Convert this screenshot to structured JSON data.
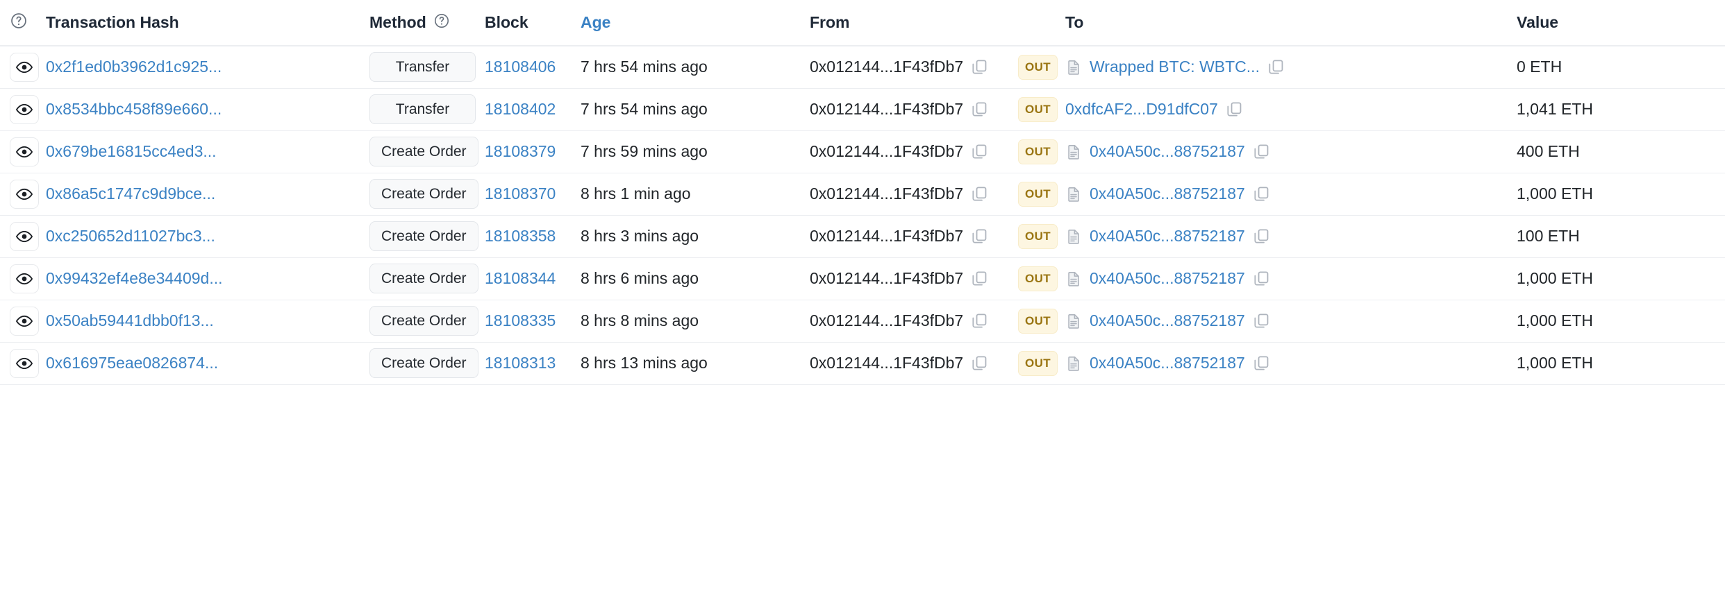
{
  "colors": {
    "link": "#3b82c4",
    "text": "#212529",
    "badge_bg": "#f8f9fa",
    "badge_border": "#e3e6ea",
    "out_bg": "#fdf6e1",
    "out_text": "#9a7512",
    "row_border": "#eceef1"
  },
  "table": {
    "headers": {
      "eye": "",
      "transaction_hash": "Transaction Hash",
      "method": "Method",
      "block": "Block",
      "age": "Age",
      "from": "From",
      "to": "To",
      "value": "Value"
    },
    "rows": [
      {
        "hash": "0x2f1ed0b3962d1c925...",
        "method": "Transfer",
        "block": "18108406",
        "age": "7 hrs 54 mins ago",
        "from": "0x012144...1F43fDb7",
        "direction": "OUT",
        "to": "Wrapped BTC: WBTC...",
        "to_is_contract": true,
        "value": "0 ETH"
      },
      {
        "hash": "0x8534bbc458f89e660...",
        "method": "Transfer",
        "block": "18108402",
        "age": "7 hrs 54 mins ago",
        "from": "0x012144...1F43fDb7",
        "direction": "OUT",
        "to": "0xdfcAF2...D91dfC07",
        "to_is_contract": false,
        "value": "1,041 ETH"
      },
      {
        "hash": "0x679be16815cc4ed3...",
        "method": "Create Order",
        "block": "18108379",
        "age": "7 hrs 59 mins ago",
        "from": "0x012144...1F43fDb7",
        "direction": "OUT",
        "to": "0x40A50c...88752187",
        "to_is_contract": true,
        "value": "400 ETH"
      },
      {
        "hash": "0x86a5c1747c9d9bce...",
        "method": "Create Order",
        "block": "18108370",
        "age": "8 hrs 1 min ago",
        "from": "0x012144...1F43fDb7",
        "direction": "OUT",
        "to": "0x40A50c...88752187",
        "to_is_contract": true,
        "value": "1,000 ETH"
      },
      {
        "hash": "0xc250652d11027bc3...",
        "method": "Create Order",
        "block": "18108358",
        "age": "8 hrs 3 mins ago",
        "from": "0x012144...1F43fDb7",
        "direction": "OUT",
        "to": "0x40A50c...88752187",
        "to_is_contract": true,
        "value": "100 ETH"
      },
      {
        "hash": "0x99432ef4e8e34409d...",
        "method": "Create Order",
        "block": "18108344",
        "age": "8 hrs 6 mins ago",
        "from": "0x012144...1F43fDb7",
        "direction": "OUT",
        "to": "0x40A50c...88752187",
        "to_is_contract": true,
        "value": "1,000 ETH"
      },
      {
        "hash": "0x50ab59441dbb0f13...",
        "method": "Create Order",
        "block": "18108335",
        "age": "8 hrs 8 mins ago",
        "from": "0x012144...1F43fDb7",
        "direction": "OUT",
        "to": "0x40A50c...88752187",
        "to_is_contract": true,
        "value": "1,000 ETH"
      },
      {
        "hash": "0x616975eae0826874...",
        "method": "Create Order",
        "block": "18108313",
        "age": "8 hrs 13 mins ago",
        "from": "0x012144...1F43fDb7",
        "direction": "OUT",
        "to": "0x40A50c...88752187",
        "to_is_contract": true,
        "value": "1,000 ETH"
      }
    ]
  },
  "icons": {
    "help": "question-mark-circle",
    "eye": "eye",
    "copy": "copy",
    "document": "document"
  }
}
